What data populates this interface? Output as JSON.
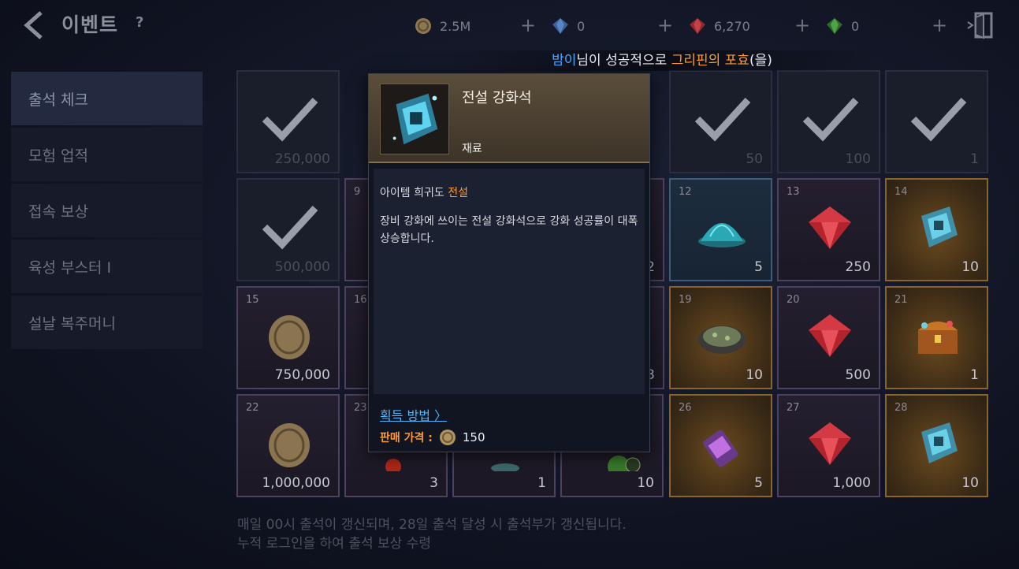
{
  "header": {
    "title": "이벤트",
    "help": "?",
    "currencies": [
      {
        "name": "gold",
        "value": "2.5M",
        "plus": "+"
      },
      {
        "name": "blue-gem",
        "value": "0",
        "plus": "+"
      },
      {
        "name": "red-gem",
        "value": "6,270",
        "plus": "+"
      },
      {
        "name": "green-gem",
        "value": "0",
        "plus": "+"
      }
    ]
  },
  "notice": {
    "name": "밤이",
    "mid": "님이 성공적으로 ",
    "item": "그리핀의 포효",
    "end": "(을)"
  },
  "sidebar": {
    "items": [
      {
        "label": "출석 체크"
      },
      {
        "label": "모험 업적"
      },
      {
        "label": "접속 보상"
      },
      {
        "label": "육성 부스터 I"
      },
      {
        "label": "설날 복주머니"
      }
    ]
  },
  "grid": {
    "row1": [
      {
        "qty": "250,000"
      },
      {
        "qty": ""
      },
      {
        "qty": "50"
      },
      {
        "qty": "100"
      },
      {
        "qty": "1"
      }
    ],
    "row2": [
      {
        "qty": "500,000"
      },
      {
        "day": "9",
        "qty": ""
      },
      {
        "day": "",
        "qty": "2"
      },
      {
        "day": "12",
        "qty": "5"
      },
      {
        "day": "13",
        "qty": "250"
      },
      {
        "day": "14",
        "qty": "10"
      }
    ],
    "row3": [
      {
        "day": "15",
        "qty": "750,000"
      },
      {
        "day": "16",
        "qty": ""
      },
      {
        "day": "",
        "qty": "3"
      },
      {
        "day": "19",
        "qty": "10"
      },
      {
        "day": "20",
        "qty": "500"
      },
      {
        "day": "21",
        "qty": "1"
      }
    ],
    "row4": [
      {
        "day": "22",
        "qty": "1,000,000"
      },
      {
        "day": "23",
        "qty": "3"
      },
      {
        "day": "",
        "qty": "1"
      },
      {
        "day": "",
        "qty": "10"
      },
      {
        "day": "26",
        "qty": "5"
      },
      {
        "day": "27",
        "qty": "1,000"
      },
      {
        "day": "28",
        "qty": "10"
      }
    ]
  },
  "popup": {
    "name": "전설 강화석",
    "type": "재료",
    "rarity_label": "아이템 희귀도",
    "rarity_value": "전설",
    "description": "장비 강화에 쓰이는 전설 강화석으로 강화 성공률이 대폭 상승합니다.",
    "howto": "획득 방법 〉",
    "price_label": "판매 가격 :",
    "price_value": "150"
  },
  "footer": {
    "line1": "매일 00시 출석이 갱신되며, 28일 출석 달성 시 출석부가 갱신됩니다.",
    "line2": "누적 로그인을 하여 출석 보상 수령"
  },
  "colors": {
    "accent_blue": "#4ea9ff",
    "accent_orange": "#ff9b2e",
    "legend_border": "#8a6428"
  }
}
